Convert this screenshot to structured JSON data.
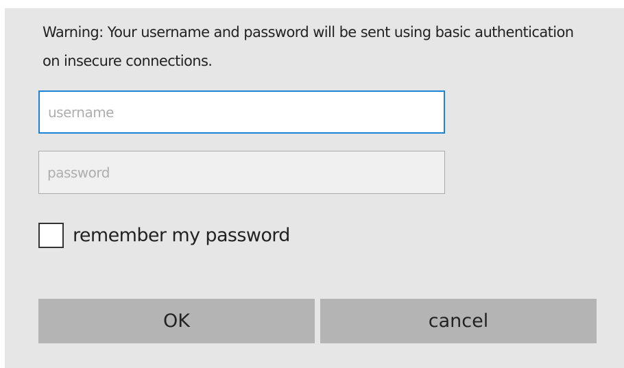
{
  "dialog": {
    "warning_text": "Warning: Your username and password will be sent using basic authentication on insecure connections.",
    "username": {
      "value": "",
      "placeholder": "username"
    },
    "password": {
      "value": "",
      "placeholder": "password"
    },
    "remember": {
      "label": "remember my password",
      "checked": false
    },
    "buttons": {
      "ok_label": "OK",
      "cancel_label": "cancel"
    }
  },
  "colors": {
    "dialog_background": "#e6e6e6",
    "focused_border": "#1d82d4",
    "button_background": "#b4b4b4"
  }
}
